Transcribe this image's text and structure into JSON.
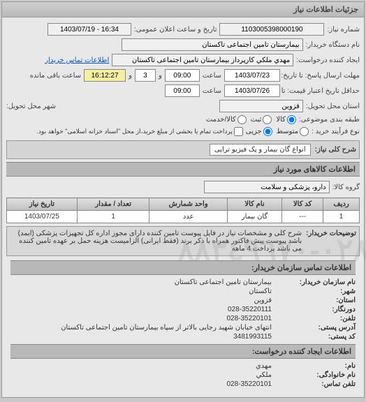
{
  "panel": {
    "title": "جزئیات اطلاعات نیاز"
  },
  "header": {
    "req_no_label": "شماره نیاز:",
    "req_no": "1103005398000190",
    "pub_date_label": "تاریخ و ساعت اعلان عمومی:",
    "pub_date": "1403/07/19 - 16:34",
    "buyer_org_label": "نام دستگاه خریدار:",
    "buyer_org": "بیمارستان تامین اجتماعی تاکستان",
    "creator_label": "ایجاد کننده درخواست:",
    "creator": "مهدي ملكي کارپرداز بیمارستان تامین اجتماعی تاکستان",
    "contact_link": "اطلاعات تماس خریدار",
    "resp_to_label": "مهلت ارسال پاسخ: تا تاریخ:",
    "resp_date": "1403/07/23",
    "resp_time_label": "ساعت",
    "resp_time": "09:00",
    "and_label": "و",
    "remain_days": "3",
    "remain_time_label": "و",
    "remain_time": "16:12:27",
    "remain_suffix": "ساعت باقی مانده",
    "valid_to_label": "حداقل تاریخ اعتبار قیمت: تا تاریخ:",
    "valid_date": "1403/07/26",
    "valid_time_label": "ساعت",
    "valid_time": "09:00",
    "province_label": "استان محل تحویل:",
    "province": "قزوین",
    "city_label": "شهر محل تحویل:",
    "class_label": "طبقه بندی موضوعی:",
    "class_opts": [
      "کالا",
      "ثبت",
      "کالا/خدمت"
    ],
    "process_label": "نوع فرآیند خرید :",
    "process_opts": [
      "متوسط",
      "جزیی"
    ],
    "process_note": "پرداخت تمام یا بخشی از مبلغ خرید،از محل \"اسناد خزانه اسلامی\" خواهد بود."
  },
  "need": {
    "title_label": "شرح کلی نیاز:",
    "title": "انواع گان بیمار و پک فیزیو تراپی",
    "items_section": "اطلاعات کالاهای مورد نیاز",
    "group_label": "گروه کالا:",
    "group": "دارو، پزشکی و سلامت"
  },
  "table": {
    "headers": [
      "ردیف",
      "کد کالا",
      "نام کالا",
      "واحد شمارش",
      "تعداد / مقدار",
      "تاریخ نیاز"
    ],
    "rows": [
      {
        "idx": "1",
        "code": "---",
        "name": "گان بیمار",
        "unit": "عدد",
        "qty": "1",
        "date": "1403/07/25"
      }
    ]
  },
  "explain": {
    "label": "توضیحات خریدار:",
    "text": "شرح کلی و مشخصات نیاز در فایل پیوست تامین کننده دارای مجوز اداره کل تجهیزات پزشکی (ایمد) باشد پیوست پیش فاکتور همراه با ذکر برند (فقط ایرانی) الزامیست هزینه حمل بر عهده تامین کننده می باشد پرداخت 4 ماهه"
  },
  "contact": {
    "section": "اطلاعات تماس سازمان خریدار:",
    "org_label": "نام سازمان خریدار:",
    "org": "بیمارستان تامین اجتماعی تاکستان",
    "city_label": "شهر:",
    "city": "تاکستان",
    "province_label": "استان:",
    "province": "قزوين",
    "fax_label": "دورنگار:",
    "fax": "028-35220111",
    "phone_label": "تلفن:",
    "phone": "028-35220101",
    "addr_label": "آدرس پستی:",
    "addr": "انتهای خیابان شهید رجایی بالاتر از سپاه بیمارستان تامین اجتماعی تاکستان",
    "post_label": "کد پستی:",
    "post": "3481993115",
    "creator_section": "اطلاعات ایجاد کننده درخواست:",
    "cname_label": "نام:",
    "cname": "مهدي",
    "clast_label": "نام خانوادگی:",
    "clast": "ملكي",
    "cphone_label": "تلفن تماس:",
    "cphone": "028-35220101"
  },
  "watermark": "٠٢٨-٨٨٣٤٩٦٧٠"
}
